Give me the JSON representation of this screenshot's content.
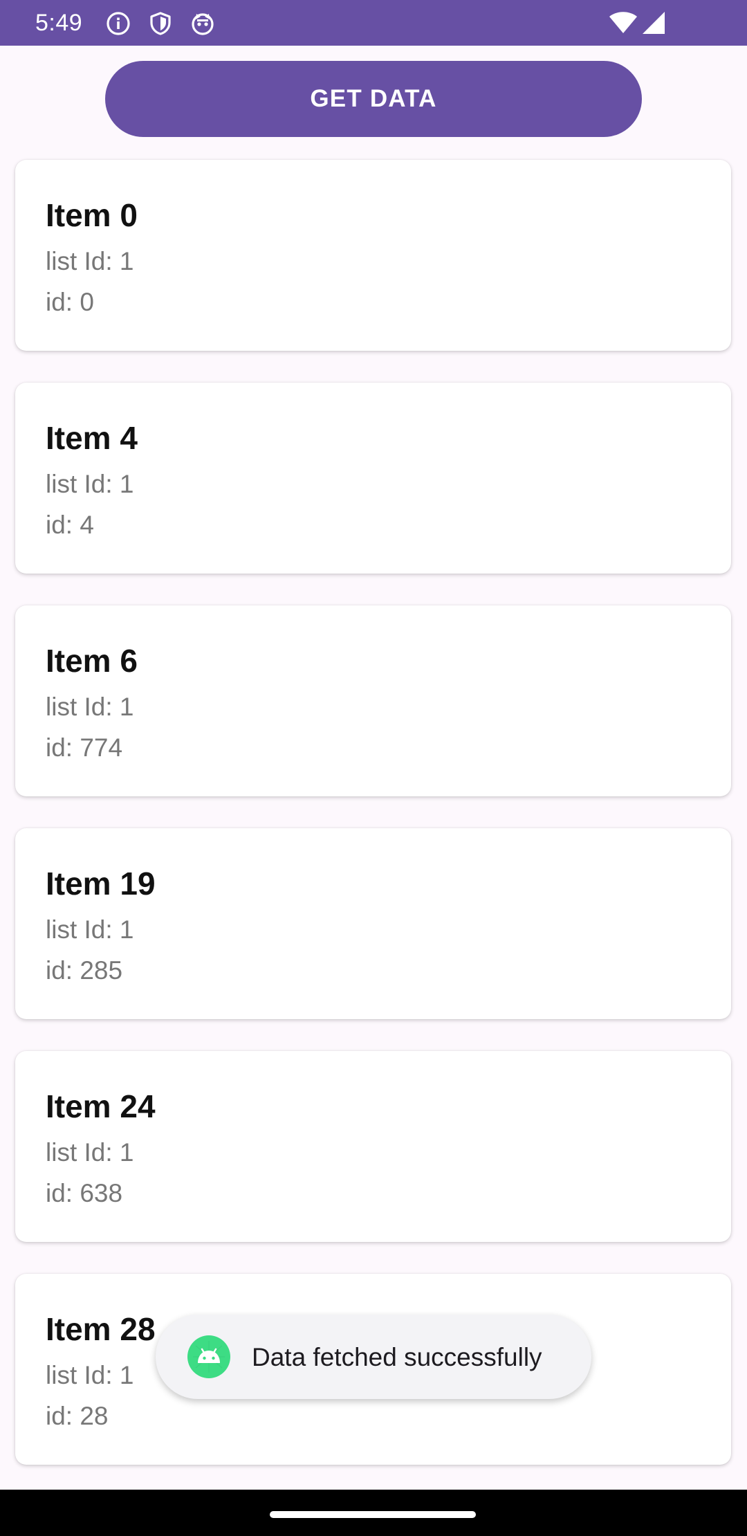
{
  "status_bar": {
    "time": "5:49",
    "bg_color": "#6750a4",
    "icons": [
      "info-icon",
      "shield-icon",
      "cat-icon",
      "wifi-icon",
      "signal-icon"
    ]
  },
  "toolbar": {
    "get_data_label": "GET DATA",
    "accent_color": "#6750a4"
  },
  "items": [
    {
      "title": "Item 0",
      "list_id": "list Id: 1",
      "id": "id: 0"
    },
    {
      "title": "Item 4",
      "list_id": "list Id: 1",
      "id": "id: 4"
    },
    {
      "title": "Item 6",
      "list_id": "list Id: 1",
      "id": "id: 774"
    },
    {
      "title": "Item 19",
      "list_id": "list Id: 1",
      "id": "id: 285"
    },
    {
      "title": "Item 24",
      "list_id": "list Id: 1",
      "id": "id: 638"
    },
    {
      "title": "Item 28",
      "list_id": "list Id: 1",
      "id": "id: 28"
    }
  ],
  "toast": {
    "message": "Data fetched successfully",
    "icon": "android-icon"
  }
}
